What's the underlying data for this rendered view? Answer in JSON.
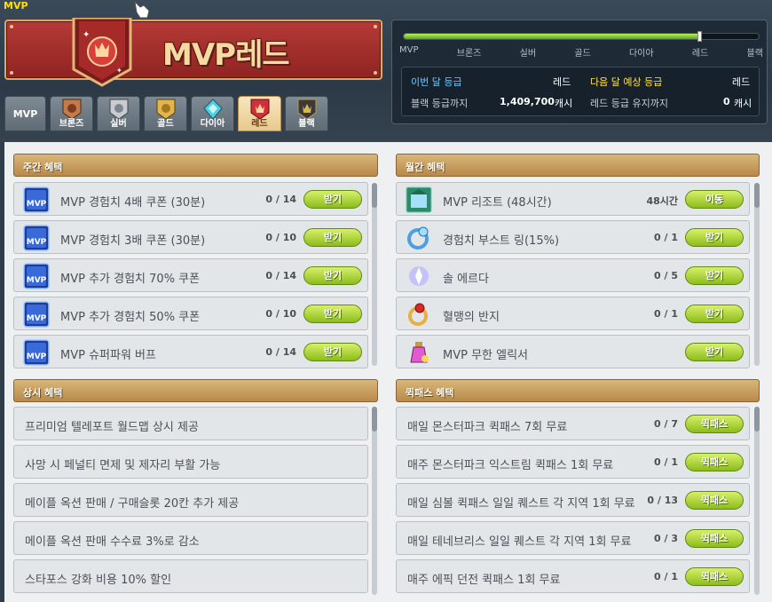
{
  "window": {
    "title": "MVP"
  },
  "banner": {
    "title": "MVP레드"
  },
  "tabs": [
    {
      "label": "MVP"
    },
    {
      "label": "브론즈",
      "color": "#c47a4a"
    },
    {
      "label": "실버",
      "color": "#c8ccd0"
    },
    {
      "label": "골드",
      "color": "#e2b64a"
    },
    {
      "label": "다이아",
      "color": "#4fd0e0"
    },
    {
      "label": "레드",
      "color": "#d0303a",
      "active": true
    },
    {
      "label": "블랙",
      "color": "#3a3a3a"
    }
  ],
  "grade": {
    "progress": 0.835,
    "levels": [
      "MVP",
      "브론즈",
      "실버",
      "골드",
      "다이아",
      "레드",
      "블랙"
    ],
    "this_month_label": "이번 달 등급",
    "this_month_value": "레드",
    "next_month_label": "다음 달 예상 등급",
    "next_month_value": "레드",
    "to_black_label": "블랙 등급까지",
    "to_black_amount": "1,409,700",
    "to_black_unit": "캐시",
    "keep_red_label": "레드 등급 유지까지",
    "keep_red_amount": "0",
    "keep_red_unit": "캐시"
  },
  "weekly": {
    "title": "주간 혜택",
    "items": [
      {
        "label": "MVP 경험치 4배 쿠폰 (30분)",
        "count": "0 / 14",
        "button": "받기",
        "icon": "mvp-4x-coupon-icon"
      },
      {
        "label": "MVP 경험치 3배 쿠폰 (30분)",
        "count": "0 / 10",
        "button": "받기",
        "icon": "mvp-3x-coupon-icon"
      },
      {
        "label": "MVP 추가 경험치 70% 쿠폰",
        "count": "0 / 14",
        "button": "받기",
        "icon": "mvp-exp70-coupon-icon"
      },
      {
        "label": "MVP 추가 경험치 50% 쿠폰",
        "count": "0 / 10",
        "button": "받기",
        "icon": "mvp-exp50-coupon-icon"
      },
      {
        "label": "MVP 슈퍼파워 버프",
        "count": "0 / 14",
        "button": "받기",
        "icon": "mvp-superpower-icon"
      }
    ]
  },
  "monthly": {
    "title": "월간 혜택",
    "items": [
      {
        "label": "MVP 리조트 (48시간)",
        "count": "48시간",
        "button": "이동",
        "icon": "resort-icon"
      },
      {
        "label": "경험치 부스트 링(15%)",
        "count": "0 / 1",
        "button": "받기",
        "icon": "boost-ring-icon"
      },
      {
        "label": "솔 에르다",
        "count": "0 / 5",
        "button": "받기",
        "icon": "sol-erda-icon"
      },
      {
        "label": "혈맹의 반지",
        "count": "0 / 1",
        "button": "받기",
        "icon": "blood-ring-icon"
      },
      {
        "label": "MVP 무한 엘릭서",
        "count": "",
        "button": "받기",
        "icon": "elixir-icon"
      }
    ]
  },
  "permanent": {
    "title": "상시 혜택",
    "items": [
      {
        "label": "프리미엄 텔레포트 월드맵 상시 제공"
      },
      {
        "label": "사망 시 페널티 면제 및 제자리 부활 가능"
      },
      {
        "label": "메이플 옥션 판매 / 구매슬롯 20칸 추가 제공"
      },
      {
        "label": "메이플 옥션 판매 수수료 3%로 감소"
      },
      {
        "label": "스타포스 강화 비용 10% 할인"
      }
    ]
  },
  "quickpass": {
    "title": "퀵패스 혜택",
    "items": [
      {
        "label": "매일 몬스터파크 퀵패스 7회 무료",
        "count": "0 / 7",
        "button": "퀵패스"
      },
      {
        "label": "매주 몬스터파크 익스트림 퀵패스 1회 무료",
        "count": "0 / 1",
        "button": "퀵패스"
      },
      {
        "label": "매일 심볼 퀵패스 일일 퀘스트 각 지역 1회 무료",
        "count": "0 / 13",
        "button": "퀵패스"
      },
      {
        "label": "매일 테네브리스 일일 퀘스트 각 지역 1회 무료",
        "count": "0 / 3",
        "button": "퀵패스"
      },
      {
        "label": "매주 에픽 던전 퀵패스 1회 무료",
        "count": "0 / 1",
        "button": "퀵패스"
      }
    ]
  }
}
